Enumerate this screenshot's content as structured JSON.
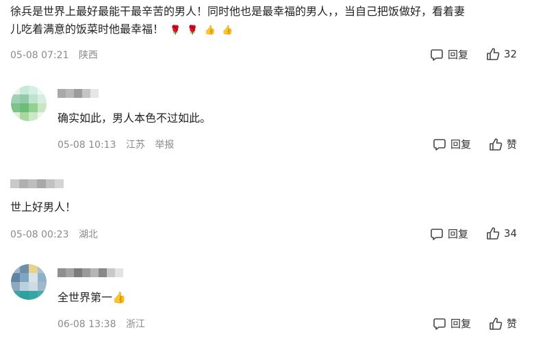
{
  "comments": [
    {
      "text_line1": "徐兵是世界上最好最能干最辛苦的男人！同时他也是最幸福的男人，，当自己把饭做好，看着妻",
      "text_line2": "儿吃着满意的饭菜时他最幸福！",
      "emojis": [
        "🌹",
        "🌹",
        "👍",
        "👍"
      ],
      "date": "05-08 07:21",
      "location": "陕西",
      "reply_label": "回复",
      "like_count": "32"
    },
    {
      "text": "确实如此，男人本色不过如此。",
      "date": "05-08 10:13",
      "location": "江苏",
      "report_label": "举报",
      "reply_label": "回复",
      "like_label": "赞"
    },
    {
      "text": "世上好男人！",
      "date": "05-08 00:23",
      "location": "湖北",
      "reply_label": "回复",
      "like_count": "34"
    },
    {
      "text": "全世界第一",
      "emoji": "👍",
      "date": "06-08 13:38",
      "location": "浙江",
      "reply_label": "回复",
      "like_label": "赞"
    }
  ],
  "icons": {
    "reply": "comment-bubble-icon",
    "like": "thumb-up-icon"
  },
  "colors": {
    "meta": "#8a8a8a",
    "text": "#222222"
  }
}
